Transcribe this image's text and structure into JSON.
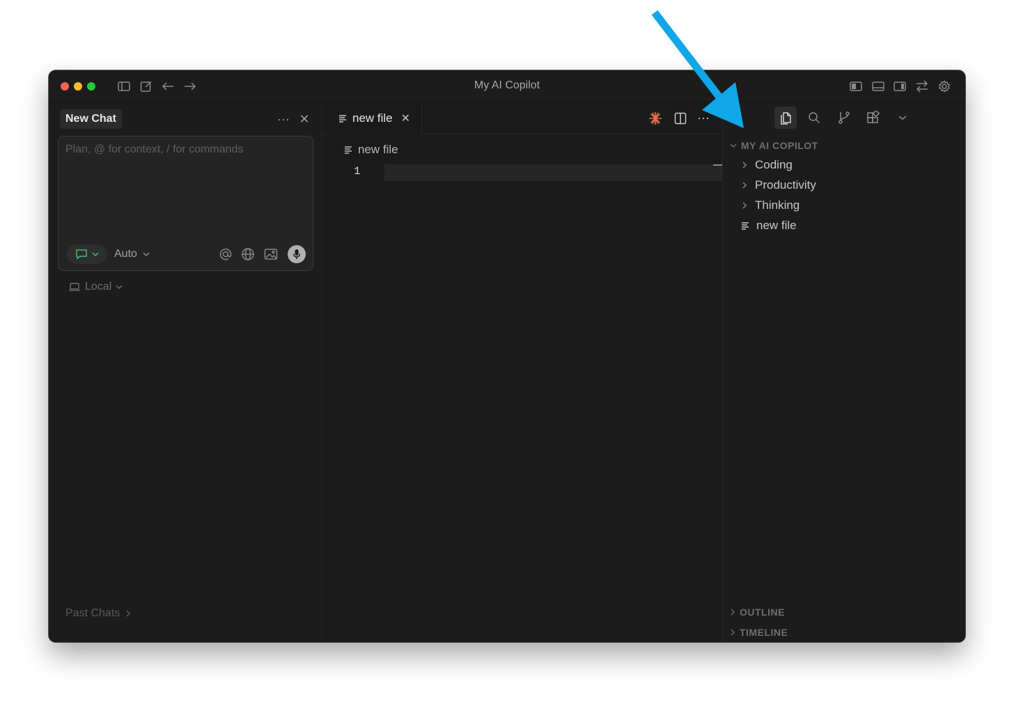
{
  "window": {
    "title": "My AI Copilot"
  },
  "chat": {
    "tab_label": "New Chat",
    "more_label": "···",
    "close_label": "✕",
    "input_placeholder": "Plan, @ for context, / for commands",
    "mode_label": "Auto",
    "environment_label": "Local",
    "past_chats_label": "Past Chats"
  },
  "editor": {
    "tab_label": "new file",
    "tab_close": "✕",
    "more_label": "···",
    "breadcrumb": "new file",
    "line_numbers": [
      "1"
    ]
  },
  "explorer": {
    "root_label": "MY AI COPILOT",
    "items": [
      {
        "label": "Coding",
        "kind": "folder"
      },
      {
        "label": "Productivity",
        "kind": "folder"
      },
      {
        "label": "Thinking",
        "kind": "folder"
      },
      {
        "label": "new file",
        "kind": "file"
      }
    ],
    "outline_label": "OUTLINE",
    "timeline_label": "TIMELINE"
  },
  "colors": {
    "traffic_red": "#ff5f57",
    "traffic_yellow": "#febc2e",
    "traffic_green": "#28c840",
    "accent_orange": "#e8734a",
    "arrow_blue": "#10a7e8"
  }
}
